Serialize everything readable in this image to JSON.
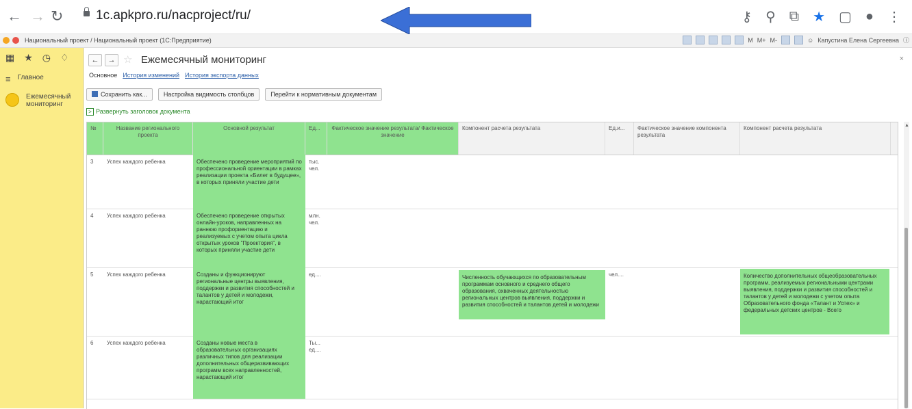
{
  "browser": {
    "back_icon": "arrow-left-icon",
    "forward_icon": "arrow-right-icon",
    "reload_icon": "reload-icon",
    "url": "1c.apkpro.ru/nacproject/ru/",
    "arrow_color": "#3b6fd6",
    "bookmark_color": "#1a73e8"
  },
  "app": {
    "window_title": "Национальный проект / Национальный проект  (1С:Предприятие)",
    "toolbar_letters": [
      "M",
      "M+",
      "M-"
    ],
    "user": "Капустина Елена Сергеевна"
  },
  "sidebar": {
    "items": [
      {
        "label": "Главное",
        "icon": "menu-icon"
      },
      {
        "label": "Ежемесячный мониторинг",
        "icon": "circle-icon"
      }
    ]
  },
  "page": {
    "title": "Ежемесячный мониторинг",
    "close": "×",
    "tabs": [
      "Основное",
      "История изменений",
      "История экспорта данных"
    ],
    "buttons": {
      "save": "Сохранить как...",
      "columns": "Настройка видимость столбцов",
      "normative": "Перейти к нормативным документам"
    },
    "expand_link": "Развернуть заголовок документа",
    "expand_box": ">",
    "accent_green": "#8fe38f"
  },
  "table": {
    "headers": [
      "№",
      "Название регионального проекта",
      "Основной результат",
      "Ед...",
      "Фактическое значение результата/ Фактическое значение",
      "Компонент расчета результата",
      "Ед.и...",
      "Фактическое значение компонента результата",
      "Компонент расчета результата"
    ],
    "rows": [
      {
        "num": "3",
        "project": "Успех каждого ребенка",
        "result": "Обеспечено проведение мероприятий по профессиональной ориентации в рамках реализации проекта «Билет в будущее», в которых приняли участие дети",
        "unit": "тыс. чел.",
        "fact": "",
        "component": "",
        "unit2": "",
        "fact2": "",
        "component2": ""
      },
      {
        "num": "4",
        "project": "Успех каждого ребенка",
        "result": "Обеспечено проведение открытых онлайн-уроков, направленных на раннюю профориентацию и реализуемых с учетом опыта цикла открытых уроков \"Проектория\", в которых приняли участие дети",
        "unit": "млн. чел.",
        "fact": "",
        "component": "",
        "unit2": "",
        "fact2": "",
        "component2": ""
      },
      {
        "num": "5",
        "project": "Успех каждого ребенка",
        "result": "Созданы и функционируют региональные центры выявления, поддержки и развития способностей и талантов у детей и молодежи, нарастающий итог",
        "unit": "ед....",
        "fact": "",
        "component": "Численность обучающихся по образовательным программам основного и среднего общего образования, охваченных деятельностью региональных центров выявления, поддержки и развития способностей и талантов детей и молодежи",
        "unit2": "чел....",
        "fact2": "",
        "component2": "Количество дополнительных общеобразовательных программ, реализуемых региональными центрами выявления, поддержки и развития способностей и талантов у детей и молодежи с учетом опыта Образовательного фонда «Талант и Успех» и федеральных детских центров - Всего"
      },
      {
        "num": "6",
        "project": "Успех каждого ребенка",
        "result": "Созданы новые места в образовательных организациях различных типов для реализации дополнительных общеразвивающих программ всех направленностей, нарастающий итог",
        "unit": "Ты... ед....",
        "fact": "",
        "component": "",
        "unit2": "",
        "fact2": "",
        "component2": ""
      }
    ]
  }
}
